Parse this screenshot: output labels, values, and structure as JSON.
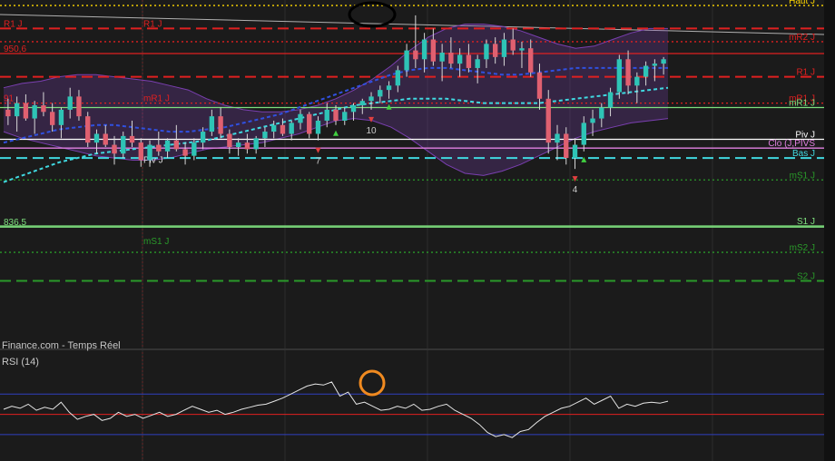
{
  "watermark": "Finance.com - Temps Réel",
  "indicator_label": "RSI (14)",
  "colors": {
    "background": "#1b1b1b",
    "up_candle": "#2ec4b6",
    "down_candle": "#e06070",
    "resistance": "#e02020",
    "support": "#7ee07e",
    "support_dark": "#2a9a2a",
    "pivot": "#ffffff",
    "bollinger": "#7a3fb0",
    "ma_short": "#3050e0",
    "ma_long": "#40d8e0",
    "annotation_black": "#000000",
    "annotation_orange": "#f08a20"
  },
  "chart_data": {
    "type": "candlestick",
    "price_ylim": [
      817,
      975
    ],
    "levels": [
      {
        "name": "Haut J",
        "value": 972.5,
        "style": "dotted",
        "color": "#ffd700"
      },
      {
        "name": "R1 J",
        "value": 962,
        "style": "dashed",
        "color": "#e02020",
        "label_side": "left"
      },
      {
        "name": "mR2 J",
        "value": 956,
        "style": "dotted",
        "color": "#e02020"
      },
      {
        "name": "950,6",
        "value": 950.6,
        "style": "solid",
        "color": "#e02020",
        "label_side": "left"
      },
      {
        "name": "R1 J",
        "value": 940,
        "style": "dashed",
        "color": "#e02020"
      },
      {
        "name": "mR1 J",
        "value": 928,
        "style": "dotted",
        "color": "#e02020"
      },
      {
        "name": "mR1 J",
        "value": 926,
        "style": "solid",
        "color": "#7ee07e"
      },
      {
        "name": "Piv J",
        "value": 911.5,
        "style": "solid",
        "color": "#ffffff"
      },
      {
        "name": "Clo (J,PIVS",
        "value": 907.5,
        "style": "solid",
        "color": "#e080e0"
      },
      {
        "name": "Bas J",
        "value": 903,
        "style": "dashed",
        "color": "#40d8e0"
      },
      {
        "name": "mS1 J",
        "value": 893,
        "style": "dotted",
        "color": "#2a9a2a"
      },
      {
        "name": "836,5",
        "value": 871.5,
        "style": "solid",
        "color": "#7ee07e",
        "label_side": "left"
      },
      {
        "name": "S1 J",
        "value": 872,
        "style": "solid",
        "color": "#7ee07e"
      },
      {
        "name": "mS2 J",
        "value": 860,
        "style": "dotted",
        "color": "#2a9a2a"
      },
      {
        "name": "S2 J",
        "value": 847,
        "style": "dashed",
        "color": "#2a9a2a"
      }
    ],
    "left_labels": [
      {
        "text": "R1 J",
        "value": 962
      },
      {
        "text": "mR1 J",
        "value": 928
      },
      {
        "text": "Piv J",
        "value": 900
      },
      {
        "text": "mS1 J",
        "value": 863
      },
      {
        "text": "91",
        "value": 928
      }
    ],
    "candles": [
      [
        925,
        930,
        918,
        922
      ],
      [
        922,
        931,
        915,
        928
      ],
      [
        928,
        932,
        920,
        921
      ],
      [
        921,
        929,
        914,
        927
      ],
      [
        927,
        933,
        922,
        924
      ],
      [
        924,
        928,
        915,
        918
      ],
      [
        918,
        926,
        912,
        925
      ],
      [
        925,
        935,
        921,
        931
      ],
      [
        931,
        934,
        920,
        922
      ],
      [
        922,
        924,
        908,
        910
      ],
      [
        910,
        916,
        905,
        914
      ],
      [
        914,
        918,
        908,
        909
      ],
      [
        909,
        913,
        900,
        905
      ],
      [
        905,
        915,
        903,
        913
      ],
      [
        913,
        920,
        908,
        910
      ],
      [
        910,
        912,
        899,
        902
      ],
      [
        902,
        911,
        899,
        909
      ],
      [
        909,
        915,
        904,
        906
      ],
      [
        906,
        912,
        903,
        911
      ],
      [
        911,
        918,
        906,
        907
      ],
      [
        907,
        910,
        900,
        904
      ],
      [
        904,
        912,
        902,
        910
      ],
      [
        910,
        917,
        907,
        915
      ],
      [
        915,
        925,
        913,
        922
      ],
      [
        922,
        926,
        912,
        914
      ],
      [
        914,
        916,
        905,
        908
      ],
      [
        908,
        912,
        904,
        910
      ],
      [
        910,
        914,
        905,
        907
      ],
      [
        907,
        913,
        905,
        912
      ],
      [
        912,
        917,
        908,
        915
      ],
      [
        915,
        920,
        912,
        918
      ],
      [
        918,
        921,
        913,
        914
      ],
      [
        914,
        920,
        911,
        919
      ],
      [
        919,
        925,
        916,
        923
      ],
      [
        923,
        924,
        912,
        914
      ],
      [
        914,
        922,
        911,
        920
      ],
      [
        920,
        928,
        917,
        925
      ],
      [
        925,
        927,
        918,
        920
      ],
      [
        920,
        926,
        918,
        924
      ],
      [
        924,
        928,
        920,
        927
      ],
      [
        927,
        930,
        923,
        929
      ],
      [
        929,
        933,
        925,
        931
      ],
      [
        931,
        936,
        928,
        934
      ],
      [
        934,
        938,
        930,
        936
      ],
      [
        936,
        945,
        933,
        943
      ],
      [
        943,
        955,
        940,
        952
      ],
      [
        952,
        968,
        944,
        948
      ],
      [
        948,
        960,
        942,
        957
      ],
      [
        957,
        962,
        945,
        947
      ],
      [
        947,
        955,
        938,
        951
      ],
      [
        951,
        958,
        944,
        946
      ],
      [
        946,
        953,
        940,
        950
      ],
      [
        950,
        955,
        942,
        944
      ],
      [
        944,
        950,
        937,
        948
      ],
      [
        948,
        957,
        944,
        955
      ],
      [
        955,
        958,
        946,
        949
      ],
      [
        949,
        960,
        945,
        957
      ],
      [
        957,
        962,
        950,
        952
      ],
      [
        952,
        956,
        944,
        953
      ],
      [
        953,
        957,
        940,
        942
      ],
      [
        942,
        946,
        925,
        930
      ],
      [
        930,
        934,
        905,
        910
      ],
      [
        910,
        918,
        902,
        914
      ],
      [
        914,
        917,
        900,
        903
      ],
      [
        903,
        912,
        898,
        909
      ],
      [
        909,
        922,
        906,
        919
      ],
      [
        919,
        925,
        913,
        921
      ],
      [
        921,
        928,
        917,
        926
      ],
      [
        926,
        935,
        922,
        933
      ],
      [
        933,
        950,
        930,
        948
      ],
      [
        948,
        952,
        932,
        936
      ],
      [
        936,
        942,
        928,
        940
      ],
      [
        940,
        947,
        936,
        945
      ],
      [
        945,
        948,
        938,
        946
      ],
      [
        946,
        949,
        941,
        948
      ]
    ],
    "bollinger": {
      "upper": [
        935,
        937,
        938,
        940,
        941,
        941,
        940,
        939,
        938,
        936,
        934,
        930,
        927,
        925,
        924,
        924,
        925,
        927,
        930,
        934,
        939,
        945,
        952,
        958,
        962,
        964,
        964,
        963,
        961,
        958,
        955,
        953,
        954,
        957,
        960,
        962,
        962
      ],
      "lower": [
        915,
        912,
        910,
        908,
        906,
        904,
        903,
        902,
        902,
        903,
        905,
        907,
        908,
        909,
        910,
        912,
        914,
        917,
        920,
        921,
        920,
        917,
        912,
        906,
        900,
        896,
        895,
        897,
        900,
        904,
        908,
        912,
        915,
        917,
        919,
        920,
        921
      ]
    },
    "ma_short": [
      910,
      912,
      914,
      916,
      917,
      918,
      918,
      917,
      916,
      915,
      915,
      916,
      917,
      919,
      921,
      923,
      926,
      929,
      932,
      935,
      938,
      941,
      943,
      944,
      944,
      943,
      942,
      941,
      941,
      942,
      943,
      944,
      944,
      944,
      944,
      944,
      944
    ],
    "ma_long": [
      892,
      895,
      898,
      901,
      903,
      905,
      906,
      907,
      908,
      909,
      910,
      911,
      913,
      915,
      917,
      919,
      921,
      923,
      925,
      927,
      928,
      929,
      930,
      930,
      930,
      929,
      928,
      928,
      928,
      928,
      929,
      930,
      931,
      932,
      933,
      934,
      935
    ],
    "arrows": [
      {
        "index": 35,
        "dir": "down",
        "label": "7"
      },
      {
        "index": 37,
        "dir": "up",
        "label": ""
      },
      {
        "index": 41,
        "dir": "down",
        "label": "10"
      },
      {
        "index": 43,
        "dir": "up",
        "label": ""
      },
      {
        "index": 64,
        "dir": "down",
        "label": "4"
      },
      {
        "index": 65,
        "dir": "up",
        "label": ""
      }
    ],
    "rsi": {
      "label": "RSI (14)",
      "ylim": [
        20,
        90
      ],
      "levels": [
        70,
        50,
        30
      ],
      "values": [
        55,
        58,
        56,
        60,
        54,
        57,
        55,
        62,
        52,
        45,
        48,
        50,
        44,
        46,
        52,
        48,
        50,
        46,
        49,
        52,
        48,
        50,
        54,
        58,
        55,
        52,
        54,
        50,
        52,
        55,
        57,
        59,
        60,
        63,
        66,
        70,
        74,
        78,
        80,
        79,
        82,
        68,
        72,
        60,
        62,
        58,
        54,
        55,
        58,
        56,
        60,
        54,
        55,
        58,
        60,
        54,
        50,
        46,
        40,
        32,
        28,
        30,
        27,
        33,
        35,
        42,
        48,
        52,
        56,
        58,
        62,
        66,
        60,
        64,
        68,
        56,
        60,
        58,
        61,
        62,
        61,
        63
      ]
    }
  }
}
